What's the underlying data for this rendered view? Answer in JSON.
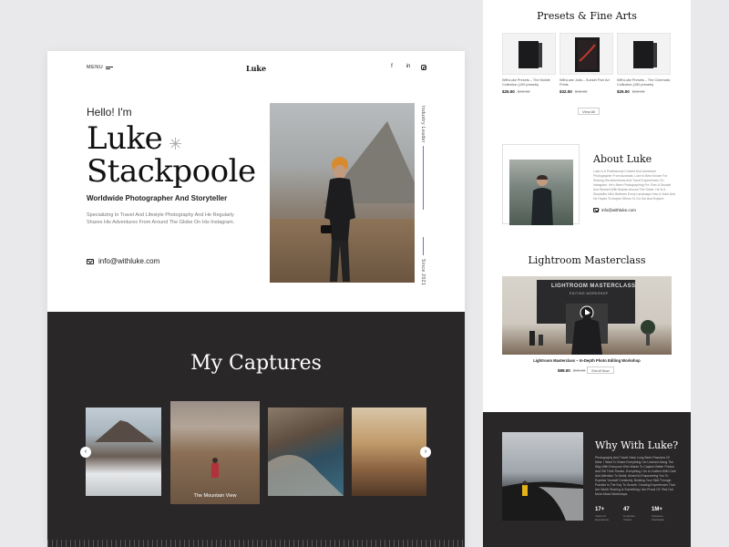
{
  "main": {
    "nav": {
      "menu_label": "MENU",
      "logo": "Luke",
      "social": [
        "f",
        "in"
      ]
    },
    "hero": {
      "greeting": "Hello! I'm",
      "name_line1": "Luke",
      "name_line2": "Stackpoole",
      "tagline": "Worldwide Photographer And Storyteller",
      "description": "Specializing In Travel And Lifestyle Photography And He Regularly Shares His Adventures From Around The Globe On His Instagram.",
      "email": "info@withluke.com",
      "side_top": "Industry Leader",
      "side_bottom": "Since 2021"
    },
    "captures": {
      "title": "My Captures",
      "featured_label": "The Mountain View"
    }
  },
  "secondary": {
    "presets": {
      "title": "Presets & Fine Arts",
      "items": [
        {
          "name": "WithLuke Presets – The Mobile Collection (100 presets)",
          "price": "$25.00",
          "old_price": "$49.00"
        },
        {
          "name": "WithLuke Julia – Sunset Fine Art Prints",
          "price": "$32.00",
          "old_price": "$45.00"
        },
        {
          "name": "WithLuke Presets – The Cinematic Collection (150 presets)",
          "price": "$25.00",
          "old_price": "$49.00"
        }
      ],
      "view_all": "View All"
    },
    "about": {
      "title": "About Luke",
      "text": "Luke Is A Professional Content And Adventure Photographer From Australia. Luke Is Best Known For Sharing His Adventures And Travel Experiences On Instagram. He's Been Photographing For Over A Decade And Worked With Brands Around The Globe. He Is A Storyteller Who Believes Every Landscape Has A Voice And He Hopes To Inspire Others To Go Out And Explore.",
      "email": "info@withluke.com"
    },
    "masterclass": {
      "title": "Lightroom Masterclass",
      "screen_title": "LIGHTROOM MASTERCLASS",
      "screen_sub": "EDITING WORKSHOP",
      "caption": "Lightroom Masterclass – In-Depth Photo Editing Workshop",
      "price": "$89.00",
      "old_price": "$99.00",
      "button": "Enroll Now"
    },
    "why": {
      "title": "Why With Luke?",
      "text": "Photography And Travel Have Long Been Passions Of Mine. I Want To Share Everything I've Learned Along The Way With Everyone Who Wants To Capture Better Photos And Tell Their Stories. Everything I Do Is Crafted With Care And Attention To Detail, Aimed At Empowering You To Express Yourself Creatively. Building Your Skill Through Practice Is The Key To Growth. Creating Experiences That Are Worth Sharing Is Something I Am Proud Of. Find Out More About Workshops.",
      "stats": [
        {
          "num": "17+",
          "label": "Years Of Experience"
        },
        {
          "num": "47",
          "label": "Countries Visited"
        },
        {
          "num": "1M+",
          "label": "Followers Worldwide"
        }
      ]
    }
  },
  "colors": {
    "dark_bg": "#2a2729",
    "accent_line": "#7a6fb0",
    "page_bg": "#e9e9eb"
  }
}
